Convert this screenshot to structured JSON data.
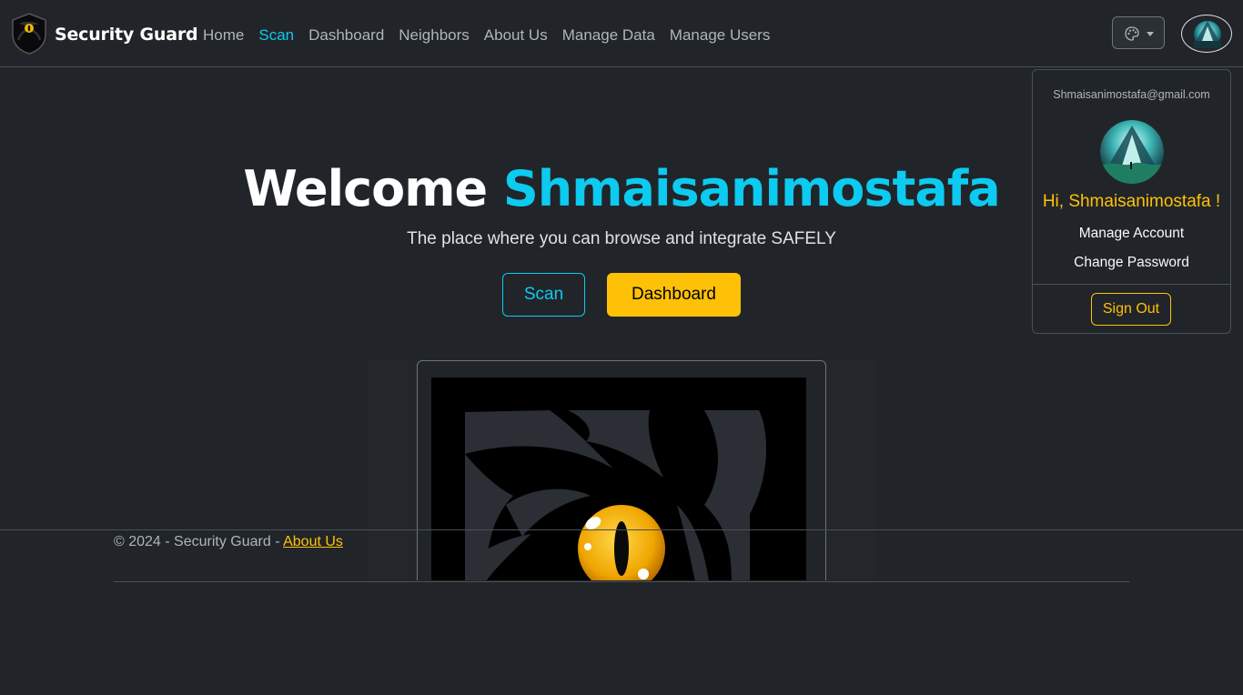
{
  "brand": {
    "name": "Security Guard"
  },
  "nav": {
    "links": [
      {
        "label": "Home"
      },
      {
        "label": "Scan",
        "active": true
      },
      {
        "label": "Dashboard"
      },
      {
        "label": "Neighbors"
      },
      {
        "label": "About Us"
      },
      {
        "label": "Manage Data"
      },
      {
        "label": "Manage Users"
      }
    ],
    "theme_icon": "palette-icon"
  },
  "user_menu": {
    "email": "Shmaisanimostafa@gmail.com",
    "greeting": "Hi, Shmaisanimostafa !",
    "items": [
      "Manage Account",
      "Change Password"
    ],
    "sign_out": "Sign Out"
  },
  "hero": {
    "welcome": "Welcome",
    "username": "Shmaisanimostafa",
    "subtitle": "The place where you can browse and integrate SAFELY",
    "scan_button": "Scan",
    "dashboard_button": "Dashboard"
  },
  "footer": {
    "copyright": "© 2024 - Security Guard - ",
    "about_link": "About Us"
  },
  "colors": {
    "accent": "#0dcaf0",
    "warning": "#ffc107",
    "background": "#212529"
  }
}
